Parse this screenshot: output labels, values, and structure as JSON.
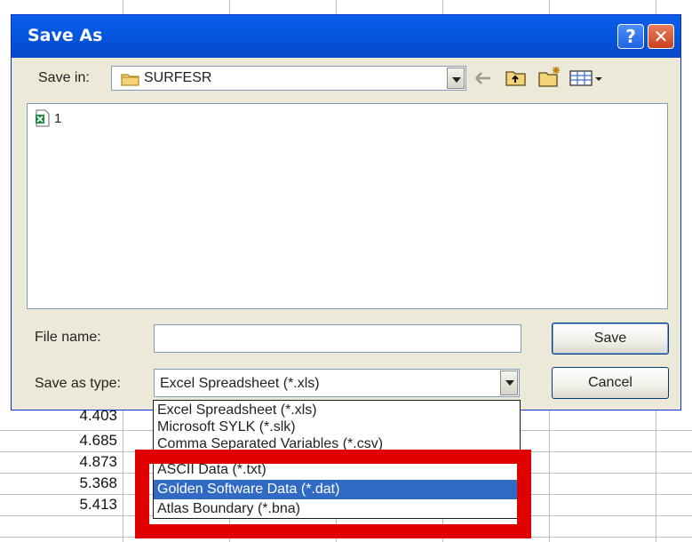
{
  "dialog": {
    "title": "Save As",
    "help_glyph": "?",
    "close_glyph": "✕",
    "save_in_label": "Save in:",
    "save_in_value": "SURFESR",
    "file_list": [
      {
        "name": "1",
        "icon": "excel-file-icon"
      }
    ],
    "file_name_label": "File name:",
    "file_name_value": "",
    "save_as_type_label": "Save as type:",
    "save_as_type_value": "Excel Spreadsheet (*.xls)",
    "save_button": "Save",
    "cancel_button": "Cancel",
    "toolbar_icons": [
      "back-arrow-icon",
      "up-folder-icon",
      "new-folder-icon",
      "views-menu-icon"
    ]
  },
  "type_dropdown": {
    "options": [
      "Excel Spreadsheet (*.xls)",
      "Microsoft SYLK (*.slk)",
      "Comma Separated Variables (*.csv)",
      "ASCII Data (*.txt)",
      "Golden Software Data (*.dat)",
      "Atlas Boundary (*.bna)"
    ],
    "selected_index": 4
  },
  "spreadsheet": {
    "visible_values": [
      "4.403",
      "4.685",
      "4.873",
      "5.368",
      "5.413"
    ]
  },
  "colors": {
    "highlight_box": "#e00000",
    "selection": "#316ac5",
    "titlebar": "#0458e0"
  }
}
